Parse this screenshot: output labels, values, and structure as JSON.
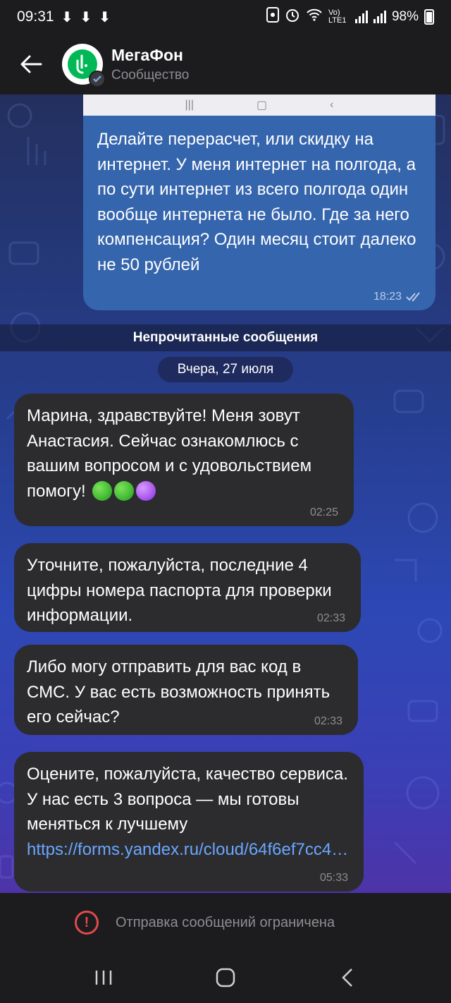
{
  "status_bar": {
    "time": "09:31",
    "downloads": [
      "⬇",
      "⬇",
      "⬇"
    ],
    "network": "Vo) LTE1",
    "battery": "98%"
  },
  "header": {
    "title": "МегаФон",
    "subtitle": "Сообщество"
  },
  "outgoing": {
    "text": "Делайте перерасчет, или скидку на интернет. У меня интернет на полгода, а по сути интернет из всего полгода один вообще интернета не было. Где за него компенсация? Один месяц стоит далеко не 50 рублей",
    "time": "18:23"
  },
  "unread_label": "Непрочитанные сообщения",
  "date_label": "Вчера, 27 июля",
  "messages": [
    {
      "text": "Марина, здравствуйте! Меня зовут Анастасия. Сейчас ознакомлюсь с вашим вопросом и с удовольствием помогу!",
      "time": "02:25"
    },
    {
      "text": "Уточните, пожалуйста, последние 4 цифры номера паспорта для проверки информации.",
      "time": "02:33"
    },
    {
      "text": "Либо могу отправить для вас код в СМС. У вас есть возможность принять его сейчас?",
      "time": "02:33"
    },
    {
      "text": "Оцените, пожалуйста, качество сервиса. У нас есть 3 вопроса — мы готовы меняться к лучшему",
      "link": "https://forms.yandex.ru/cloud/64f6ef7cc4…",
      "time": "05:33"
    }
  ],
  "restricted_notice": "Отправка сообщений ограничена",
  "colors": {
    "outgoing_bubble": "#3565ad",
    "incoming_bubble": "#2c2c2e",
    "link": "#6aa6ff",
    "brand_green": "#00b956",
    "warning": "#e04a4a"
  }
}
